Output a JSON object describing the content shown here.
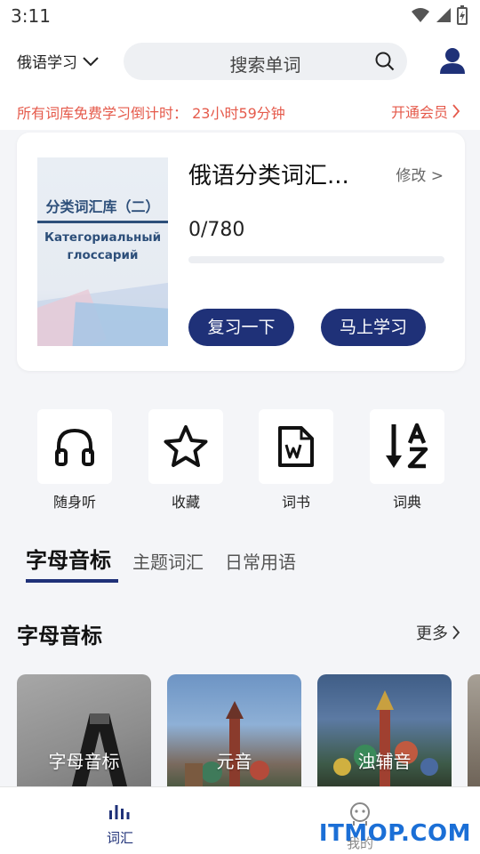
{
  "status_bar": {
    "time": "3:11"
  },
  "header": {
    "language": "俄语学习",
    "search_placeholder": "搜索单词"
  },
  "banner": {
    "countdown_text": "所有词库免费学习倒计时： 23小时59分钟",
    "vip_link": "开通会员"
  },
  "book": {
    "cover_title": "分类词汇库（二）",
    "cover_subtitle": "Категориальный глоссарий",
    "title": "俄语分类词汇...",
    "edit_label": "修改 >",
    "progress_text": "0/780",
    "progress_fraction": 0,
    "review_button": "复习一下",
    "learn_button": "马上学习"
  },
  "tools": [
    {
      "label": "随身听",
      "icon": "headphones-icon"
    },
    {
      "label": "收藏",
      "icon": "star-icon"
    },
    {
      "label": "词书",
      "icon": "word-book-icon"
    },
    {
      "label": "词典",
      "icon": "sort-az-icon"
    }
  ],
  "tabs": [
    {
      "label": "字母音标",
      "active": true
    },
    {
      "label": "主题词汇",
      "active": false
    },
    {
      "label": "日常用语",
      "active": false
    }
  ],
  "section": {
    "title": "字母音标",
    "more": "更多"
  },
  "categories": [
    {
      "label": "字母音标"
    },
    {
      "label": "元音"
    },
    {
      "label": "浊辅音"
    }
  ],
  "bottom_nav": [
    {
      "label": "词汇",
      "active": true
    },
    {
      "label": "我的",
      "active": false
    }
  ],
  "watermark": "ITMOP.COM",
  "colors": {
    "accent": "#1f3178",
    "banner_red": "#e55a4b",
    "background": "#f4f5f8"
  }
}
